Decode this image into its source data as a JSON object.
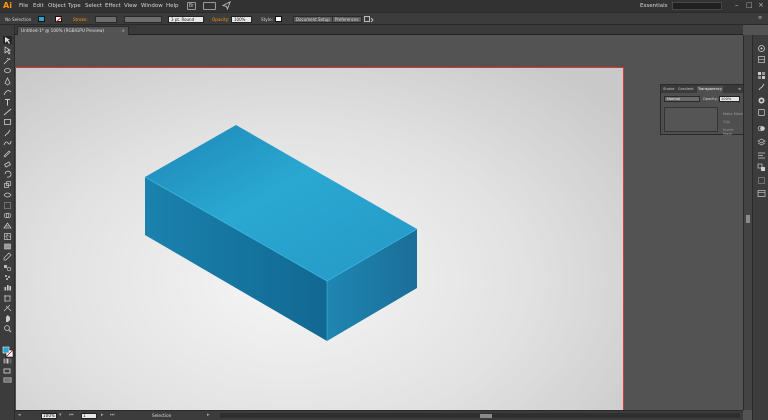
{
  "app": {
    "logo": "Ai"
  },
  "menu": {
    "items": [
      "File",
      "Edit",
      "Object",
      "Type",
      "Select",
      "Effect",
      "View",
      "Window",
      "Help"
    ],
    "workspace": "Essentials",
    "bridge_label": "Br"
  },
  "control": {
    "selection_label": "No Selection",
    "stroke_label": "Stroke:",
    "brush_label": "3 pt. Round",
    "opacity_label": "Opacity:",
    "opacity_value": "100%",
    "style_label": "Style:",
    "document_setup": "Document Setup",
    "preferences": "Preferences",
    "fill_color": "#2aa4d4",
    "accent": "#ff9a00"
  },
  "document": {
    "tab_title": "Untitled-1* @ 100% (RGB/GPU Preview)",
    "close_glyph": "×",
    "artboard_border": "#d23a3a"
  },
  "transparency_panel": {
    "tabs": [
      "Stroke",
      "Gradient",
      "Transparency"
    ],
    "blend_mode": "Normal",
    "opacity_label": "Opacity:",
    "opacity_value": "100%",
    "options": [
      "Make Mask",
      "Clip",
      "Invert Mask"
    ]
  },
  "status": {
    "zoom": "100%",
    "page": "1",
    "tool": "Selection"
  },
  "artwork": {
    "object": "isometric box",
    "colors": {
      "top_light": "#2aa8d2",
      "top_dark": "#1f7aa8",
      "left_light": "#1d84b0",
      "left_dark": "#0f5f88",
      "right_light": "#2796c0",
      "right_dark": "#1a6f99"
    }
  },
  "icons": {
    "tools": [
      "selection-tool-icon",
      "direct-selection-tool-icon",
      "magic-wand-tool-icon",
      "lasso-tool-icon",
      "pen-tool-icon",
      "curvature-tool-icon",
      "type-tool-icon",
      "line-tool-icon",
      "rectangle-tool-icon",
      "paintbrush-tool-icon",
      "shaper-tool-icon",
      "pencil-tool-icon",
      "eraser-tool-icon",
      "rotate-tool-icon",
      "scale-tool-icon",
      "width-tool-icon",
      "free-transform-tool-icon",
      "shape-builder-tool-icon",
      "perspective-grid-tool-icon",
      "mesh-tool-icon",
      "gradient-tool-icon",
      "eyedropper-tool-icon",
      "blend-tool-icon",
      "symbol-sprayer-tool-icon",
      "column-graph-tool-icon",
      "artboard-tool-icon",
      "slice-tool-icon",
      "hand-tool-icon",
      "zoom-tool-icon"
    ],
    "dock": [
      "color-panel-icon",
      "color-guide-icon",
      "swatches-icon",
      "brushes-icon",
      "symbols-icon",
      "graphic-styles-icon",
      "appearance-icon",
      "layers-icon",
      "align-icon",
      "pathfinder-icon",
      "transform-icon",
      "artboards-icon"
    ]
  }
}
